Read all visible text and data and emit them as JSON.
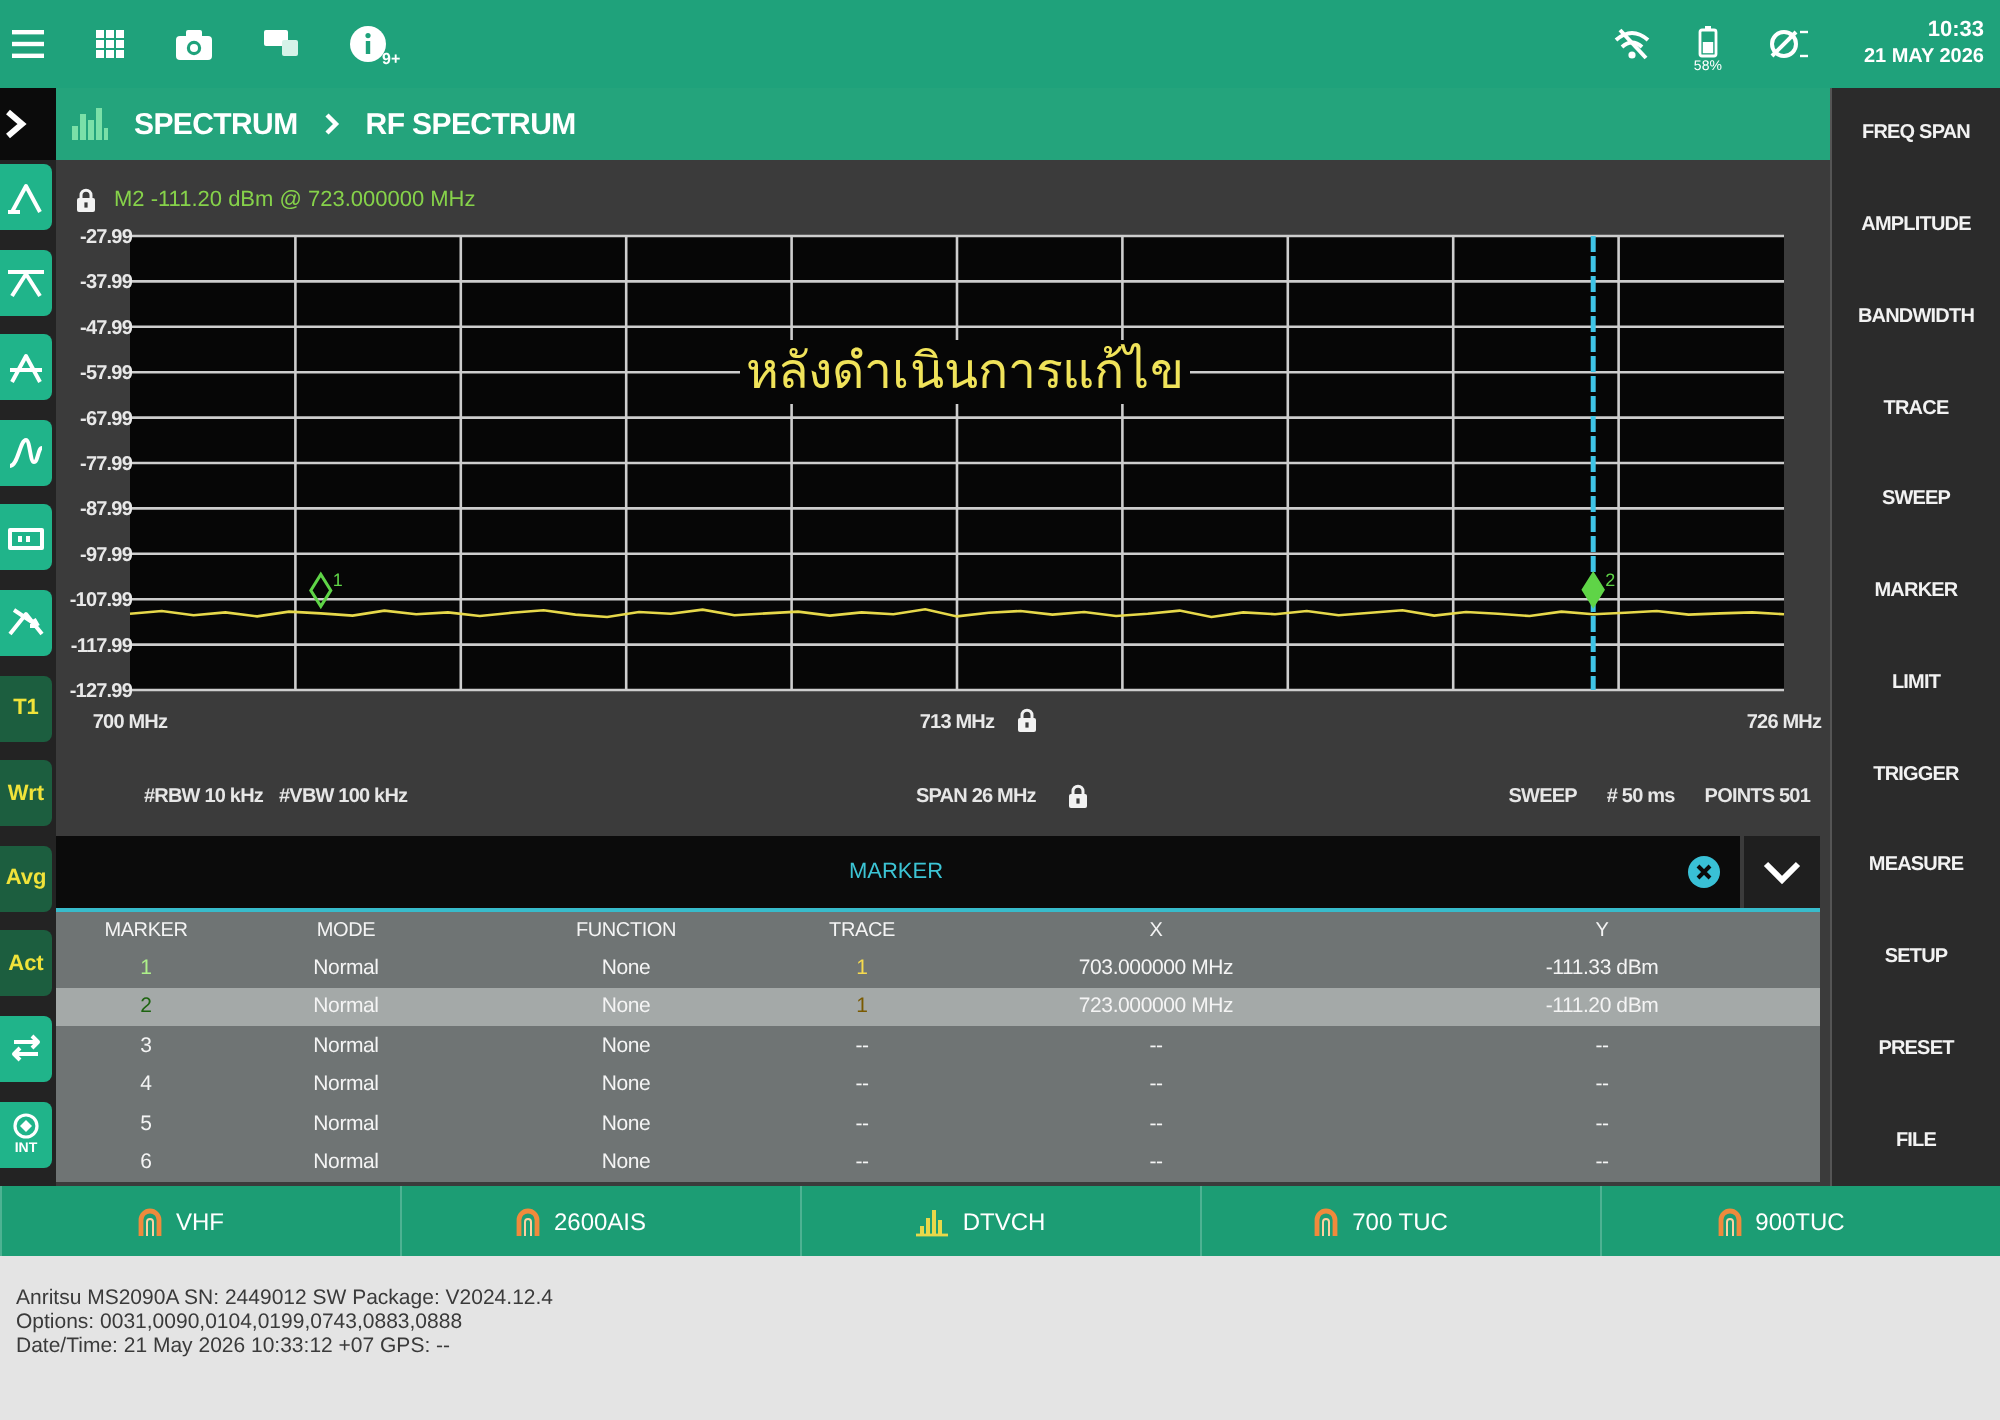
{
  "status_bar": {
    "notification_badge": "9+",
    "battery_percent": "58%",
    "time": "10:33",
    "date": "21 MAY 2026"
  },
  "header": {
    "breadcrumb": [
      "SPECTRUM",
      "RF SPECTRUM"
    ]
  },
  "left_toolbar": {
    "trace_buttons": [
      "T1",
      "Wrt",
      "Avg",
      "Act"
    ],
    "int_label": "INT"
  },
  "spectrum": {
    "marker_readout": "M2 -111.20 dBm @ 723.000000 MHz",
    "overlay_text": "หลังดำเนินการแก้ไข",
    "chart_data": {
      "type": "line",
      "grid": true,
      "x": [
        700,
        700.5,
        701,
        701.5,
        702,
        702.5,
        703,
        703.5,
        704,
        704.5,
        705,
        705.5,
        706,
        706.5,
        707,
        707.5,
        708,
        708.5,
        709,
        709.5,
        710,
        710.5,
        711,
        711.5,
        712,
        712.5,
        713,
        713.5,
        714,
        714.5,
        715,
        715.5,
        716,
        716.5,
        717,
        717.5,
        718,
        718.5,
        719,
        719.5,
        720,
        720.5,
        721,
        721.5,
        722,
        722.5,
        723,
        723.5,
        724,
        724.5,
        725,
        725.5,
        726
      ],
      "xlim": [
        700,
        726
      ],
      "ylim": [
        -127.99,
        -27.99
      ],
      "xticks": [
        {
          "value": 700,
          "label": "700 MHz"
        },
        {
          "value": 713,
          "label": "713 MHz"
        },
        {
          "value": 726,
          "label": "726 MHz"
        }
      ],
      "yticks": [
        -27.99,
        -37.99,
        -47.99,
        -57.99,
        -67.99,
        -77.99,
        -87.99,
        -97.99,
        -107.99,
        -117.99,
        -127.99
      ],
      "series": [
        {
          "color": "#e6d84a",
          "values": [
            -111.2,
            -110.6,
            -111.5,
            -110.9,
            -111.8,
            -110.7,
            -111.1,
            -111.6,
            -110.5,
            -111.3,
            -110.9,
            -111.7,
            -111.0,
            -110.4,
            -111.4,
            -111.9,
            -110.8,
            -111.2,
            -110.3,
            -111.5,
            -111.1,
            -110.7,
            -111.6,
            -110.9,
            -111.3,
            -110.2,
            -111.8,
            -111.0,
            -110.6,
            -111.4,
            -110.8,
            -111.7,
            -111.2,
            -110.5,
            -111.9,
            -110.9,
            -111.3,
            -110.6,
            -111.5,
            -111.0,
            -110.4,
            -111.6,
            -110.8,
            -111.2,
            -111.7,
            -110.7,
            -111.3,
            -111.0,
            -110.6,
            -111.4,
            -111.1,
            -110.9,
            -111.3
          ]
        }
      ],
      "ref_lines": [
        {
          "axis": "x",
          "value": 723,
          "color": "#3fc4e6"
        }
      ],
      "annotations": [
        {
          "x": 703,
          "y": -111.33,
          "text": "1"
        },
        {
          "x": 723,
          "y": -111.2,
          "text": "2"
        }
      ]
    },
    "bandwidth": [
      "#RBW 10 kHz",
      "#VBW 100 kHz"
    ],
    "span": "SPAN 26 MHz",
    "sweep": [
      "SWEEP",
      "# 50 ms",
      "POINTS 501"
    ]
  },
  "marker_panel": {
    "title": "MARKER",
    "table": {
      "columns": [
        "MARKER",
        "MODE",
        "FUNCTION",
        "TRACE",
        "X",
        "Y"
      ],
      "rows": [
        {
          "cells": [
            "1",
            "Normal",
            "None",
            "1",
            "703.000000 MHz",
            "-111.33 dBm"
          ],
          "on": true,
          "selected": false
        },
        {
          "cells": [
            "2",
            "Normal",
            "None",
            "1",
            "723.000000 MHz",
            "-111.20 dBm"
          ],
          "on": true,
          "selected": true
        },
        {
          "cells": [
            "3",
            "Normal",
            "None",
            "--",
            "--",
            "--"
          ],
          "on": false,
          "selected": false
        },
        {
          "cells": [
            "4",
            "Normal",
            "None",
            "--",
            "--",
            "--"
          ],
          "on": false,
          "selected": false
        },
        {
          "cells": [
            "5",
            "Normal",
            "None",
            "--",
            "--",
            "--"
          ],
          "on": false,
          "selected": false
        },
        {
          "cells": [
            "6",
            "Normal",
            "None",
            "--",
            "--",
            "--"
          ],
          "on": false,
          "selected": false
        }
      ]
    }
  },
  "right_menu": {
    "items": [
      "FREQ SPAN",
      "AMPLITUDE",
      "BANDWIDTH",
      "TRACE",
      "SWEEP",
      "MARKER",
      "LIMIT",
      "TRIGGER",
      "MEASURE",
      "SETUP",
      "PRESET",
      "FILE"
    ]
  },
  "preset_tabs": [
    {
      "label": "VHF",
      "kind": "preset"
    },
    {
      "label": "2600AIS",
      "kind": "preset"
    },
    {
      "label": "DTVCH",
      "kind": "spectrum"
    },
    {
      "label": "700 TUC",
      "kind": "preset"
    },
    {
      "label": "900TUC",
      "kind": "preset"
    }
  ],
  "info": {
    "lines": [
      "Anritsu MS2090A SN: 2449012 SW Package: V2024.12.4",
      "Options: 0031,0090,0104,0199,0743,0883,0888",
      "Date/Time: 21 May 2026 10:33:12 +07 GPS: --"
    ]
  }
}
